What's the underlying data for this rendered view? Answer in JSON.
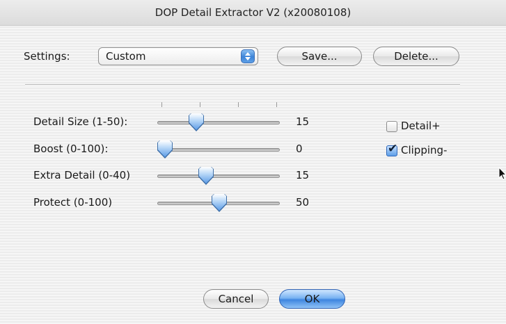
{
  "window": {
    "title": "DOP Detail Extractor  V2 (x20080108)"
  },
  "settings": {
    "label": "Settings:",
    "selected": "Custom",
    "save_label": "Save...",
    "delete_label": "Delete..."
  },
  "sliders": [
    {
      "label": "Detail Size (1-50):",
      "value": "15",
      "min": 1,
      "max": 50,
      "position": 15
    },
    {
      "label": "Boost (0-100):",
      "value": "0",
      "min": 0,
      "max": 100,
      "position": 0
    },
    {
      "label": "Extra Detail (0-40)",
      "value": "15",
      "min": 0,
      "max": 40,
      "position": 15
    },
    {
      "label": "Protect  (0-100)",
      "value": "50",
      "min": 0,
      "max": 100,
      "position": 50
    }
  ],
  "options": [
    {
      "label": "Detail+",
      "checked": false
    },
    {
      "label": "Clipping-",
      "checked": true
    }
  ],
  "footer": {
    "cancel_label": "Cancel",
    "ok_label": "OK"
  },
  "colors": {
    "accent": "#3f86e0",
    "thumb": "#5b9be6"
  }
}
